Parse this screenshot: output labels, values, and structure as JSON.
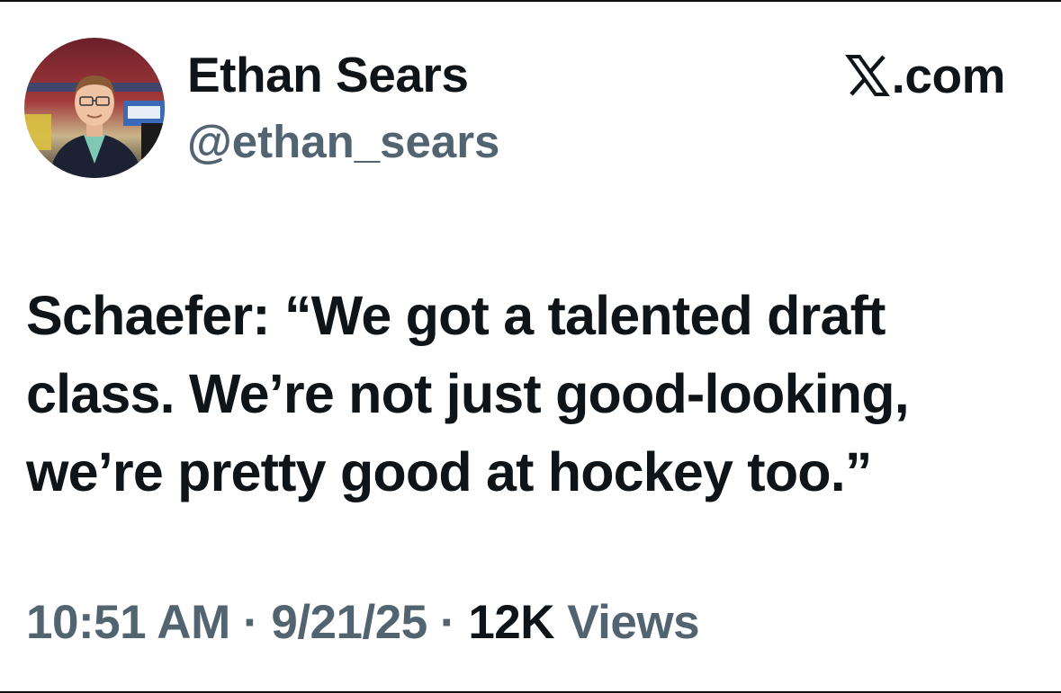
{
  "author": {
    "display_name": "Ethan Sears",
    "handle": "@ethan_sears",
    "avatar_icon": "profile-photo"
  },
  "brand": {
    "icon": "x-logo-icon",
    "text": ".com"
  },
  "tweet": {
    "text": "Schaefer: “We got a talented draft class. We’re not just good-looking, we’re pretty good at hockey too.”"
  },
  "meta": {
    "time": "10:51 AM",
    "sep1": " · ",
    "date": "9/21/25",
    "sep2": " · ",
    "views_count": "12K",
    "views_label": " Views"
  },
  "colors": {
    "text_primary": "#0f1419",
    "text_secondary": "#536471",
    "background": "#ffffff"
  }
}
